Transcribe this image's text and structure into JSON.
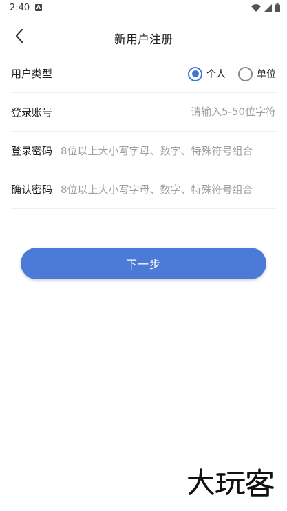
{
  "status_bar": {
    "time": "2:40",
    "notification_icon": "download-notification-icon",
    "icons": [
      "wifi-icon",
      "cellular-signal-icon",
      "battery-icon"
    ]
  },
  "app_bar": {
    "title": "新用户注册",
    "back_icon": "chevron-left-icon"
  },
  "form": {
    "user_type": {
      "label": "用户类型",
      "options": [
        {
          "label": "个人",
          "selected": true
        },
        {
          "label": "单位",
          "selected": false
        }
      ]
    },
    "account": {
      "label": "登录账号",
      "value": "",
      "placeholder": "请输入5-50位字符"
    },
    "password": {
      "label": "登录密码",
      "value": "",
      "placeholder": "8位以上大小写字母、数字、特殊符号组合"
    },
    "confirm_password": {
      "label": "确认密码",
      "value": "",
      "placeholder": "8位以上大小写字母、数字、特殊符号组合"
    }
  },
  "actions": {
    "next_label": "下一步"
  },
  "watermark": {
    "text": "大玩客"
  },
  "colors": {
    "accent": "#4b7bd6",
    "radio_selected": "#3f76d6",
    "placeholder": "#9e9e9e"
  }
}
